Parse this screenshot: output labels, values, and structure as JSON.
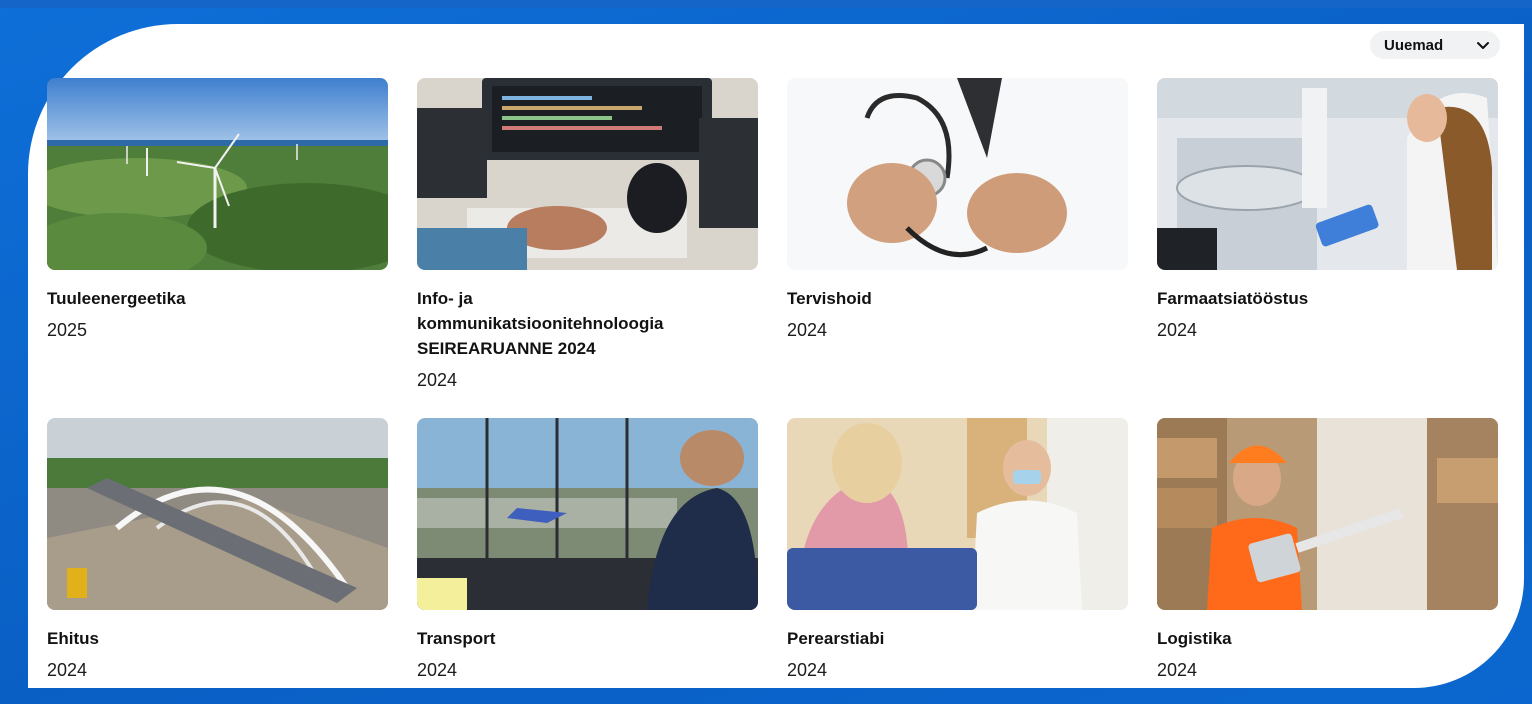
{
  "sort": {
    "label": "Uuemad",
    "icon": "chevron-down-icon"
  },
  "cards": [
    {
      "title": "Tuuleenergeetika",
      "year": "2025",
      "image": "wind-turbines-photo"
    },
    {
      "title": "Info- ja kommunikatsioonitehnoloogia SEIREARUANNE 2024",
      "year": "2024",
      "image": "programmer-screens-photo"
    },
    {
      "title": "Tervishoid",
      "year": "2024",
      "image": "doctor-stethoscope-photo"
    },
    {
      "title": "Farmaatsiatööstus",
      "year": "2024",
      "image": "laboratory-scientist-photo"
    },
    {
      "title": "Ehitus",
      "year": "2024",
      "image": "bridge-construction-photo"
    },
    {
      "title": "Transport",
      "year": "2024",
      "image": "air-traffic-control-photo"
    },
    {
      "title": "Perearstiabi",
      "year": "2024",
      "image": "family-doctor-visit-photo"
    },
    {
      "title": "Logistika",
      "year": "2024",
      "image": "warehouse-worker-photo"
    }
  ],
  "colors": {
    "brand_blue": "#0a62c6",
    "panel": "#ffffff",
    "text": "#121212"
  }
}
